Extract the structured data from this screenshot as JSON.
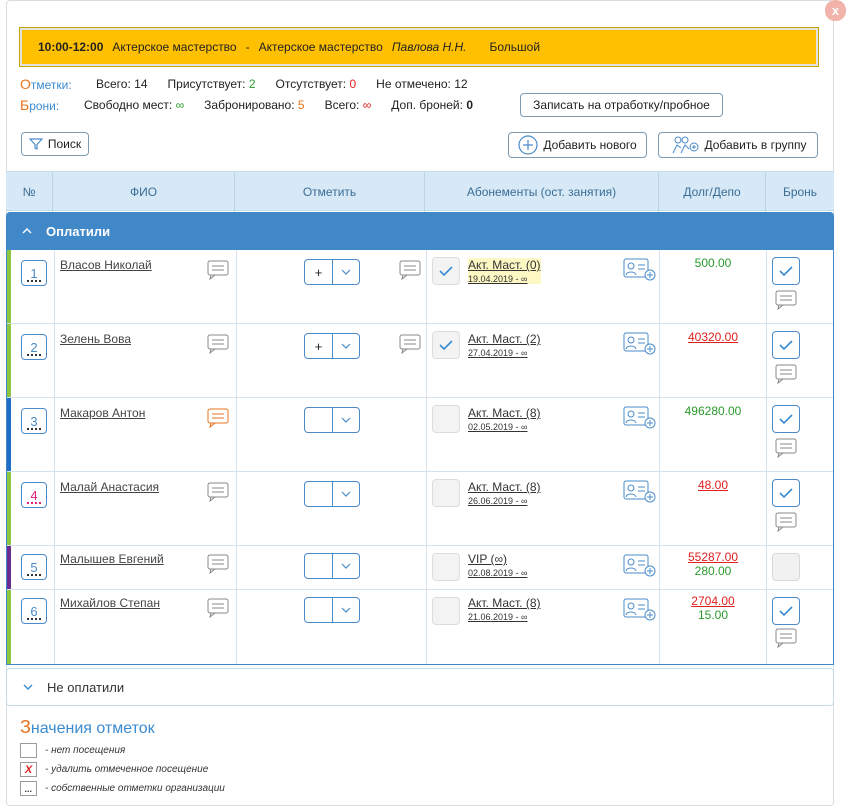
{
  "close_label": "x",
  "banner": {
    "time": "10:00-12:00",
    "subject": "Актерское мастерство",
    "separator": "-",
    "group": "Актерское мастерство",
    "teacher": "Павлова Н.Н.",
    "room": "Большой",
    "color": "#ffc000"
  },
  "marks": {
    "lead_first": "О",
    "lead_rest": "тметки:",
    "total_label": "Всего:",
    "total": "14",
    "present_label": "Присутствует:",
    "present": "2",
    "absent_label": "Отсутствует:",
    "absent": "0",
    "unmarked_label": "Не отмечено:",
    "unmarked": "12"
  },
  "bookings": {
    "lead_first": "Б",
    "lead_rest": "рони:",
    "free_label": "Свободно мест:",
    "free": "∞",
    "booked_label": "Забронировано:",
    "booked": "5",
    "total_label": "Всего:",
    "total": "∞",
    "extra_label": "Доп. броней:",
    "extra": "0"
  },
  "buttons": {
    "trial": "Записать на отработку/пробное",
    "search": "Поиск",
    "add_new": "Добавить нового",
    "add_group": "Добавить в группу"
  },
  "table": {
    "headers": [
      "№",
      "ФИО",
      "Отметить",
      "Абонементы (ост. занятия)",
      "Долг/Депо",
      "Бронь"
    ],
    "group_paid": "Оплатили",
    "group_unpaid": "Не оплатили",
    "rows": [
      {
        "num": "1",
        "name": "Власов Николай",
        "mark": "+",
        "checked": true,
        "abon": "Акт. Маст. (0)",
        "abon_date": "19.04.2019 - ∞",
        "debt_neg": "",
        "debt_pos": "500.00",
        "bron": true
      },
      {
        "num": "2",
        "name": "Зелень Вова",
        "mark": "+",
        "checked": true,
        "abon": "Акт. Маст. (2)",
        "abon_date": "27.04.2019 - ∞",
        "debt_neg": "40320.00",
        "debt_pos": "",
        "bron": true
      },
      {
        "num": "3",
        "name": "Макаров Антон",
        "mark": "",
        "checked": false,
        "abon": "Акт. Маст. (8)",
        "abon_date": "02.05.2019 - ∞",
        "debt_neg": "",
        "debt_pos": "496280.00",
        "bron": true
      },
      {
        "num": "4",
        "name": "Малай Анастасия",
        "mark": "",
        "checked": false,
        "abon": "Акт. Маст. (8)",
        "abon_date": "26.06.2019 - ∞",
        "debt_neg": "48.00",
        "debt_pos": "",
        "bron": true
      },
      {
        "num": "5",
        "name": "Малышев Евгений",
        "mark": "",
        "checked": false,
        "abon": "VIP (∞)",
        "abon_date": "02.08.2019 - ∞",
        "debt_neg": "55287.00",
        "debt_pos": "280.00",
        "bron": false
      },
      {
        "num": "6",
        "name": "Михайлов Степан",
        "mark": "",
        "checked": false,
        "abon": "Акт. Маст. (8)",
        "abon_date": "21.06.2019 - ∞",
        "debt_neg": "2704.00",
        "debt_pos": "15.00",
        "bron": true
      }
    ]
  },
  "legend": {
    "title_first": "З",
    "title_rest": "начения отметок",
    "items": [
      {
        "symbol": "",
        "text": "- нет посещения"
      },
      {
        "symbol": "X",
        "text": "- удалить отмеченное посещение"
      },
      {
        "symbol": "...",
        "text": "- собственные отметки организации"
      }
    ]
  },
  "colors": {
    "accent": "#4188c9",
    "header_bg": "#d7e9f6",
    "green": "#2a9a2a",
    "red": "#e02020",
    "orange": "#e8731c"
  }
}
